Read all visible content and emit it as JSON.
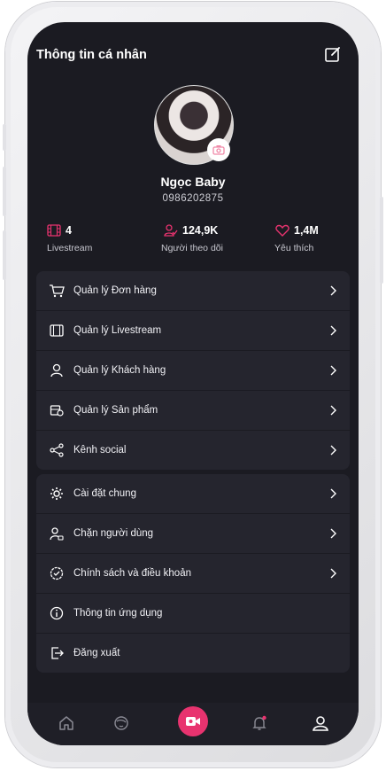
{
  "header": {
    "title": "Thông tin cá nhân",
    "edit_icon": "edit-icon"
  },
  "profile": {
    "name": "Ngọc Baby",
    "phone": "0986202875",
    "avatar_icon": "avatar",
    "camera_icon": "camera-icon"
  },
  "stats": [
    {
      "value": "4",
      "label": "Livestream",
      "icon": "film-icon",
      "color": "#e8336f"
    },
    {
      "value": "124,9K",
      "label": "Người theo dõi",
      "icon": "followers-icon",
      "color": "#e8336f"
    },
    {
      "value": "1,4M",
      "label": "Yêu thích",
      "icon": "heart-icon",
      "color": "#e8336f"
    }
  ],
  "menu_primary": [
    {
      "label": "Quản lý Đơn hàng",
      "icon": "cart-icon"
    },
    {
      "label": "Quản lý Livestream",
      "icon": "film-icon"
    },
    {
      "label": "Quản lý  Khách hàng",
      "icon": "user-icon"
    },
    {
      "label": "Quản lý  Sản phẩm",
      "icon": "product-icon"
    },
    {
      "label": "Kênh social",
      "icon": "share-icon"
    }
  ],
  "menu_secondary": [
    {
      "label": "Cài đặt chung",
      "icon": "gear-icon"
    },
    {
      "label": "Chặn người dùng",
      "icon": "block-user-icon"
    },
    {
      "label": "Chính sách và điều khoản",
      "icon": "policy-icon"
    },
    {
      "label": "Thông tin ứng dụng",
      "icon": "info-icon"
    },
    {
      "label": "Đăng xuất",
      "icon": "logout-icon"
    }
  ],
  "tabbar": {
    "items": [
      "home-icon",
      "user-face-icon",
      "video-camera-icon",
      "bell-icon",
      "profile-icon"
    ],
    "accent": "#e8336f",
    "active": "profile-icon"
  }
}
